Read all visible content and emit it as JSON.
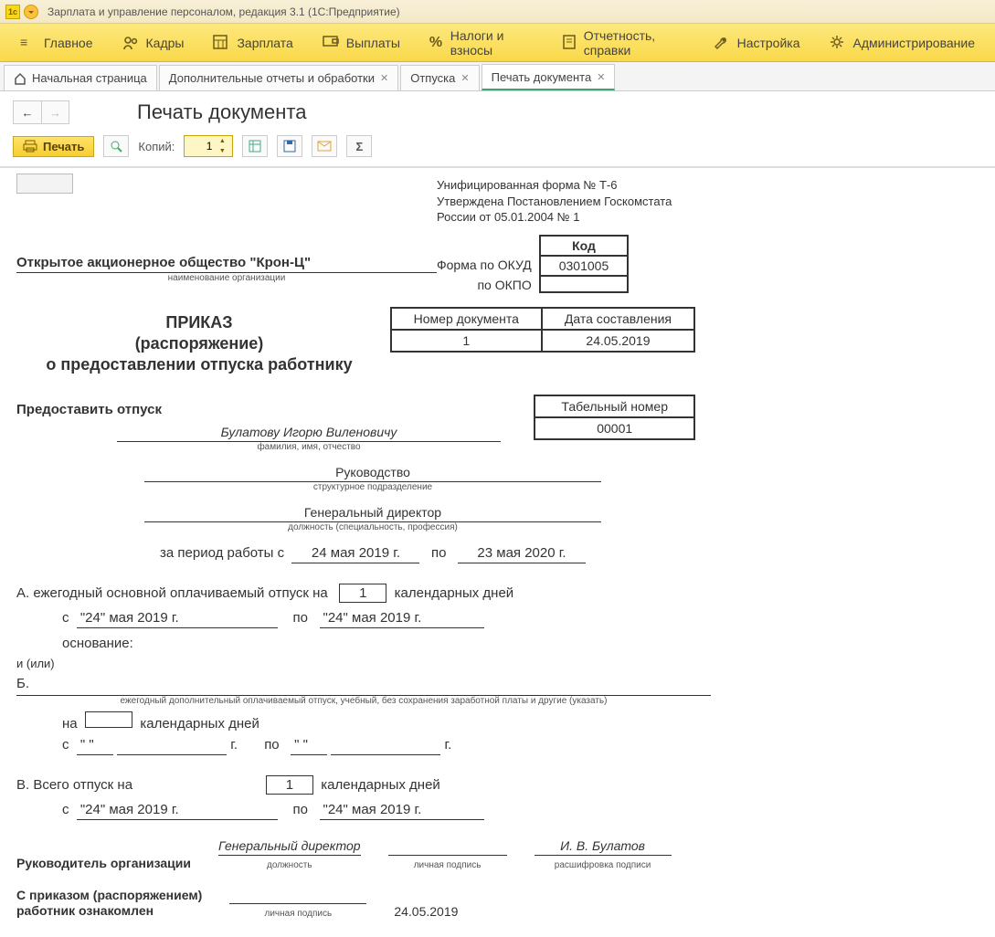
{
  "titlebar": {
    "text": "Зарплата и управление персоналом, редакция 3.1  (1С:Предприятие)"
  },
  "mainmenu": [
    {
      "label": "Главное",
      "icon": "menu"
    },
    {
      "label": "Кадры",
      "icon": "people"
    },
    {
      "label": "Зарплата",
      "icon": "calc"
    },
    {
      "label": "Выплаты",
      "icon": "wallet"
    },
    {
      "label": "Налоги и взносы",
      "icon": "percent"
    },
    {
      "label": "Отчетность, справки",
      "icon": "report"
    },
    {
      "label": "Настройка",
      "icon": "wrench"
    },
    {
      "label": "Администрирование",
      "icon": "gear"
    }
  ],
  "tabs": [
    {
      "label": "Начальная страница",
      "home": true,
      "closable": false
    },
    {
      "label": "Дополнительные отчеты и обработки",
      "closable": true
    },
    {
      "label": "Отпуска",
      "closable": true
    },
    {
      "label": "Печать документа",
      "closable": true,
      "active": true
    }
  ],
  "doctitle": "Печать документа",
  "toolbar": {
    "print": "Печать",
    "copies_label": "Копий:",
    "copies_value": "1"
  },
  "doc": {
    "form_std_1": "Унифицированная форма № Т-6",
    "form_std_2": "Утверждена Постановлением Госкомстата",
    "form_std_3": "России от 05.01.2004 № 1",
    "code_hdr": "Код",
    "okud_lbl": "Форма по ОКУД",
    "okud_val": "0301005",
    "okpo_lbl": "по ОКПО",
    "okpo_val": "",
    "org": "Открытое акционерное общество \"Крон-Ц\"",
    "org_cap": "наименование организации",
    "docnum_hdr": "Номер документа",
    "docdate_hdr": "Дата составления",
    "docnum": "1",
    "docdate": "24.05.2019",
    "title1": "ПРИКАЗ",
    "title2": "(распоряжение)",
    "title3": "о предоставлении отпуска работнику",
    "grant": "Предоставить отпуск",
    "tabnum_hdr": "Табельный номер",
    "tabnum": "00001",
    "fio": "Булатову Игорю Виленовичу",
    "fio_cap": "фамилия, имя, отчество",
    "dept": "Руководство",
    "dept_cap": "структурное подразделение",
    "pos": "Генеральный директор",
    "pos_cap": "должность (специальность, профессия)",
    "period_pre": "за период работы с",
    "period_from": "24 мая 2019 г.",
    "period_mid": "по",
    "period_to": "23 мая 2020 г.",
    "secA": "А. ежегодный основной оплачиваемый отпуск на",
    "daysA": "1",
    "kd": "календарных дней",
    "from_lbl": "с",
    "to_lbl": "по",
    "dateA_from": "\"24\" мая 2019 г.",
    "dateA_to": "\"24\" мая 2019 г.",
    "basis_lbl": "основание:",
    "andor": "и (или)",
    "secB": "Б.",
    "secB_cap": "ежегодный дополнительный оплачиваемый отпуск, учебный, без сохранения заработной платы и другие (указать)",
    "na": "на",
    "daysB": "",
    "blank_q": "\"     \"",
    "blank_y": "г.",
    "secV": "В.    Всего отпуск на",
    "daysV": "1",
    "dateV_from": "\"24\" мая 2019 г.",
    "dateV_to": "\"24\" мая 2019 г.",
    "mgr_lbl": "Руководитель организации",
    "mgr_pos": "Генеральный директор",
    "mgr_pos_cap": "должность",
    "mgr_sign_cap": "личная подпись",
    "mgr_name": "И. В. Булатов",
    "mgr_name_cap": "расшифровка подписи",
    "ack1": "С приказом (распоряжением)",
    "ack2": "работник  ознакомлен",
    "ack_date": "24.05.2019"
  }
}
